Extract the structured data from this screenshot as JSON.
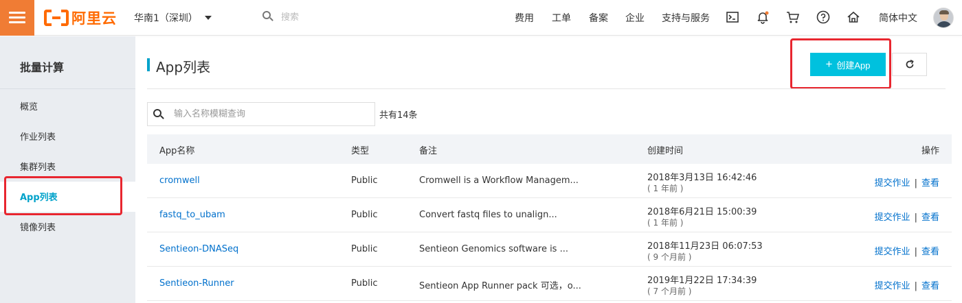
{
  "header": {
    "logo_text": "阿里云",
    "region": "华南1（深圳）",
    "search_placeholder": "搜索",
    "nav": [
      "费用",
      "工单",
      "备案",
      "企业",
      "支持与服务"
    ],
    "language": "简体中文",
    "brand_color": "#ff6a00",
    "icons": [
      "terminal-icon",
      "bell-icon",
      "cart-icon",
      "help-icon",
      "home-icon"
    ]
  },
  "sidebar": {
    "title": "批量计算",
    "items": [
      {
        "label": "概览",
        "active": false
      },
      {
        "label": "作业列表",
        "active": false
      },
      {
        "label": "集群列表",
        "active": false
      },
      {
        "label": "App列表",
        "active": true
      },
      {
        "label": "镜像列表",
        "active": false
      }
    ]
  },
  "main": {
    "title": "App列表",
    "create_label": "创建App",
    "filter_placeholder": "输入名称模糊查询",
    "total": "共有14条",
    "accent_color": "#00c1de",
    "columns": [
      "App名称",
      "类型",
      "备注",
      "创建时间",
      "操作"
    ],
    "rows": [
      {
        "name": "cromwell",
        "type": "Public",
        "note": "Cromwell is a Workflow Managem...",
        "created": "2018年3月13日 16:42:46",
        "ago": "( 1 年前 )"
      },
      {
        "name": "fastq_to_ubam",
        "type": "Public",
        "note": "Convert fastq files to unalign...",
        "created": "2018年6月21日 15:00:39",
        "ago": "( 1 年前 )"
      },
      {
        "name": "Sentieon-DNASeq",
        "type": "Public",
        "note": "Sentieon Genomics software is ...",
        "created": "2018年11月23日 06:07:53",
        "ago": "( 9 个月前 )"
      },
      {
        "name": "Sentieon-Runner",
        "type": "Public",
        "note": "Sentieon App Runner pack 可选，o...",
        "created": "2019年1月22日 17:34:39",
        "ago": "( 7 个月前 )"
      }
    ],
    "row_actions": {
      "submit": "提交作业",
      "sep": "|",
      "view": "查看"
    }
  }
}
